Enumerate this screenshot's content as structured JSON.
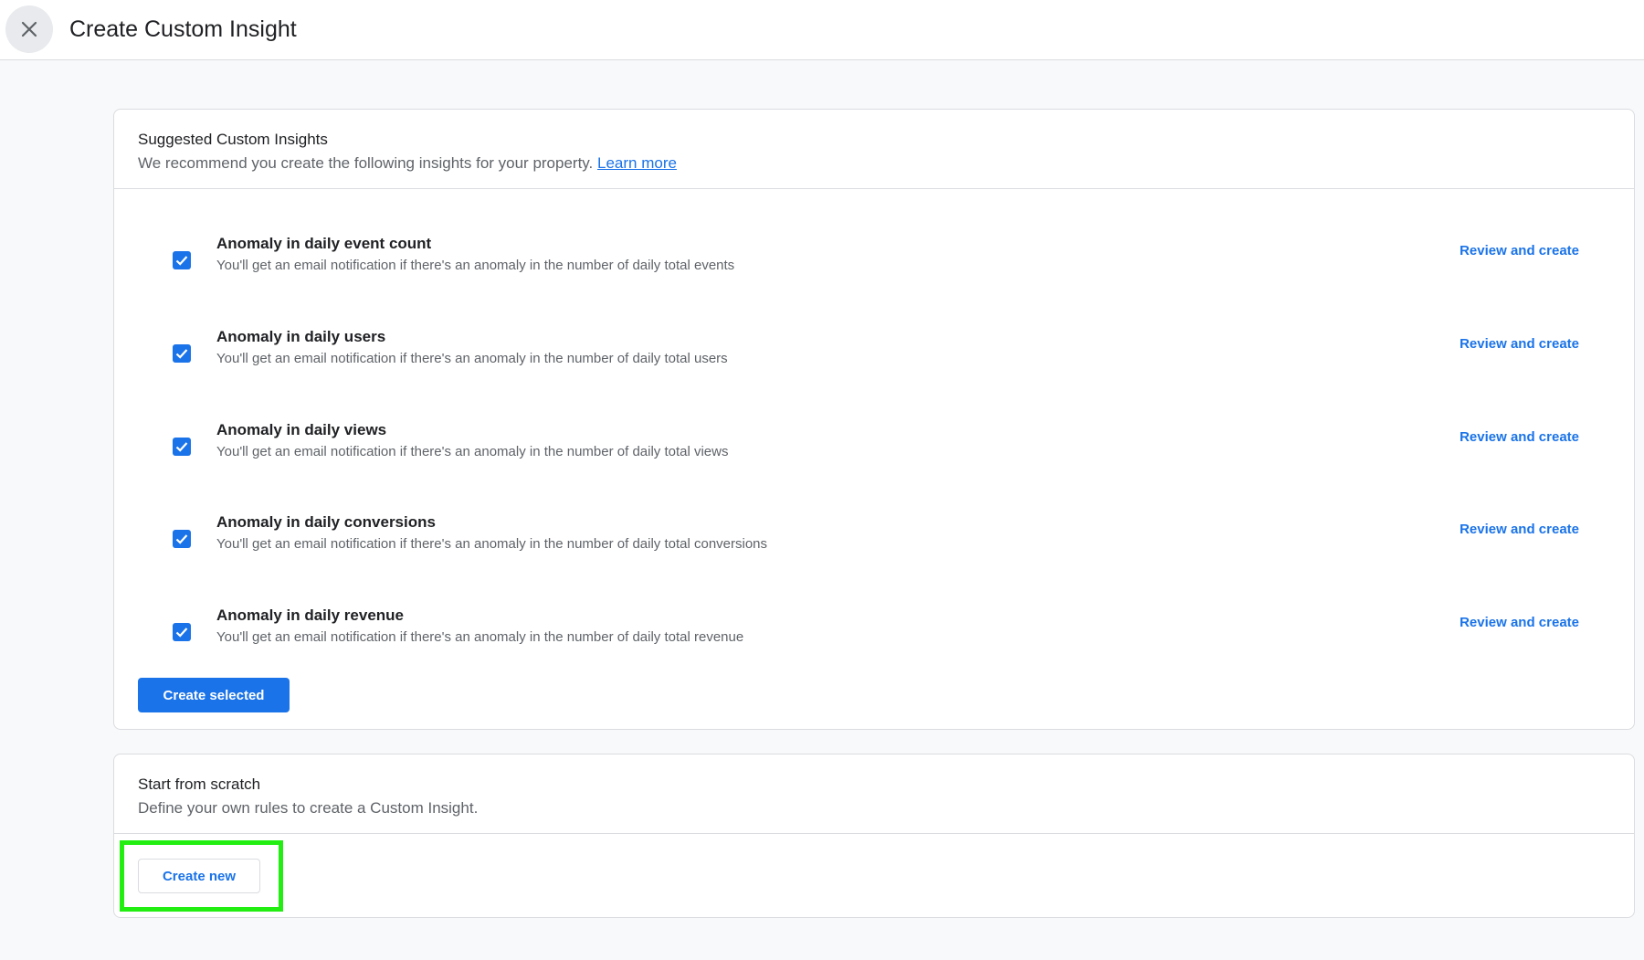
{
  "header": {
    "title": "Create Custom Insight",
    "close_icon": "close-icon"
  },
  "suggested": {
    "title": "Suggested Custom Insights",
    "subtitle": "We recommend you create the following insights for your property.",
    "learn_more": "Learn more",
    "items": [
      {
        "title": "Anomaly in daily event count",
        "description": "You'll get an email notification if there's an anomaly in the number of daily total events",
        "checked": true,
        "action": "Review and create"
      },
      {
        "title": "Anomaly in daily users",
        "description": "You'll get an email notification if there's an anomaly in the number of daily total users",
        "checked": true,
        "action": "Review and create"
      },
      {
        "title": "Anomaly in daily views",
        "description": "You'll get an email notification if there's an anomaly in the number of daily total views",
        "checked": true,
        "action": "Review and create"
      },
      {
        "title": "Anomaly in daily conversions",
        "description": "You'll get an email notification if there's an anomaly in the number of daily total conversions",
        "checked": true,
        "action": "Review and create"
      },
      {
        "title": "Anomaly in daily revenue",
        "description": "You'll get an email notification if there's an anomaly in the number of daily total revenue",
        "checked": true,
        "action": "Review and create"
      }
    ],
    "create_selected_label": "Create selected"
  },
  "scratch": {
    "title": "Start from scratch",
    "subtitle": "Define your own rules to create a Custom Insight.",
    "create_new_label": "Create new"
  },
  "colors": {
    "accent": "#1a73e8",
    "highlight": "#22ee11",
    "background": "#f8f9fa"
  }
}
